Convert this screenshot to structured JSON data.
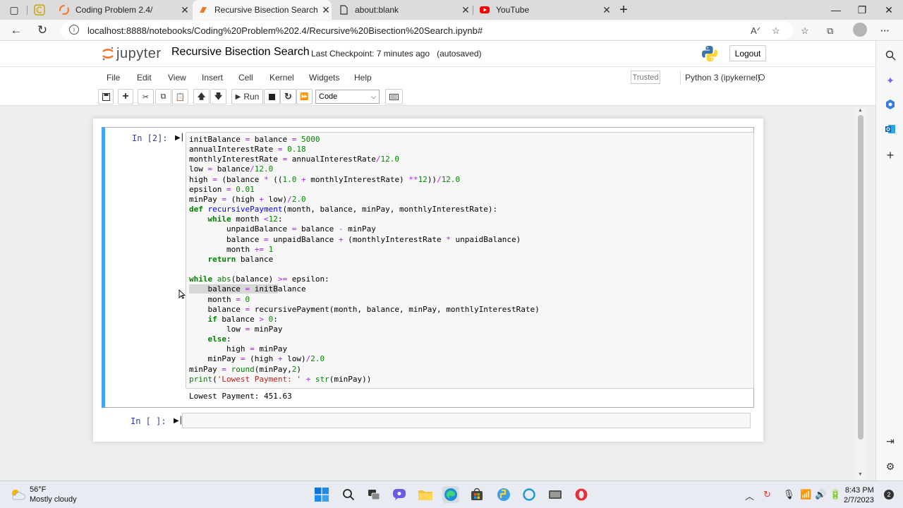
{
  "browser": {
    "tabs": [
      {
        "label": "Coding Problem 2.4/",
        "active": false
      },
      {
        "label": "Recursive Bisection Search - Jupy",
        "active": true
      },
      {
        "label": "about:blank",
        "active": false
      },
      {
        "label": "YouTube",
        "active": false
      }
    ],
    "url": "localhost:8888/notebooks/Coding%20Problem%202.4/Recursive%20Bisection%20Search.ipynb#"
  },
  "jupyter": {
    "logo_text": "jupyter",
    "notebook_name": "Recursive Bisection Search",
    "checkpoint": "Last Checkpoint: 7 minutes ago",
    "autosave": "(autosaved)",
    "logout_label": "Logout",
    "menu": [
      "File",
      "Edit",
      "View",
      "Insert",
      "Cell",
      "Kernel",
      "Widgets",
      "Help"
    ],
    "trusted_label": "Trusted",
    "kernel_name": "Python 3 (ipykernel)",
    "toolbar": {
      "run_label": "Run",
      "cell_type": "Code"
    }
  },
  "cells": [
    {
      "prompt": "In [2]:",
      "code": [
        "initBalance = balance = 5000",
        "annualInterestRate = 0.18",
        "monthlyInterestRate = annualInterestRate/12.0",
        "low = balance/12.0",
        "high = (balance * ((1.0 + monthlyInterestRate) **12))/12.0",
        "epsilon = 0.01",
        "minPay = (high + low)/2.0",
        "def recursivePayment(month, balance, minPay, monthlyInterestRate):",
        "    while month <12:",
        "        unpaidBalance = balance - minPay",
        "        balance = unpaidBalance + (monthlyInterestRate * unpaidBalance)",
        "        month += 1",
        "    return balance",
        "",
        "while abs(balance) >= epsilon:",
        "    balance = initBalance",
        "    month = 0",
        "    balance = recursivePayment(month, balance, minPay, monthlyInterestRate)",
        "    if balance > 0:",
        "        low = minPay",
        "    else:",
        "        high = minPay",
        "    minPay = (high + low)/2.0",
        "minPay = round(minPay,2)",
        "print('Lowest Payment: ' + str(minPay))"
      ],
      "output": "Lowest Payment: 451.63"
    },
    {
      "prompt": "In [ ]:",
      "code": []
    }
  ],
  "taskbar": {
    "temperature": "56°F",
    "weather": "Mostly cloudy",
    "time": "8:43 PM",
    "date": "2/7/2023",
    "notifications": "2"
  },
  "colors": {
    "cell_selected_border": "#42a5f5",
    "prompt": "#303f9f",
    "keyword": "#008000",
    "number": "#008000",
    "operator": "#aa22ff",
    "string": "#ba2121"
  }
}
